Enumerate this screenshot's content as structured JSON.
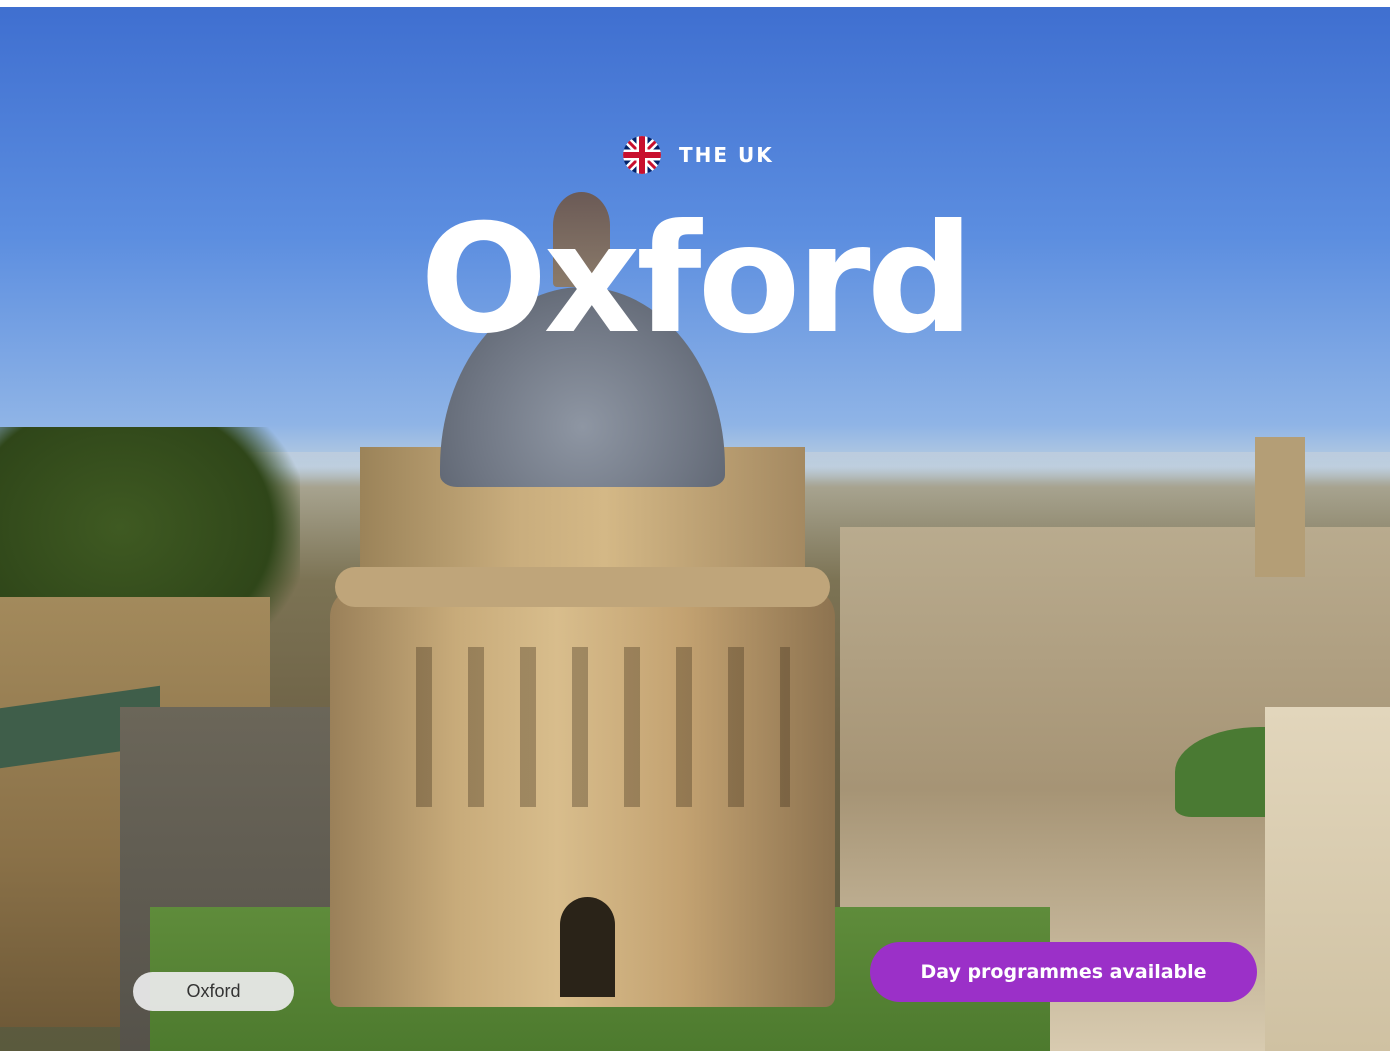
{
  "hero": {
    "country": "THE UK",
    "country_icon": "uk-flag-icon",
    "title": "Oxford",
    "location_tag": "Oxford",
    "cta_label": "Day programmes available",
    "cta_color": "#9b30c8"
  }
}
